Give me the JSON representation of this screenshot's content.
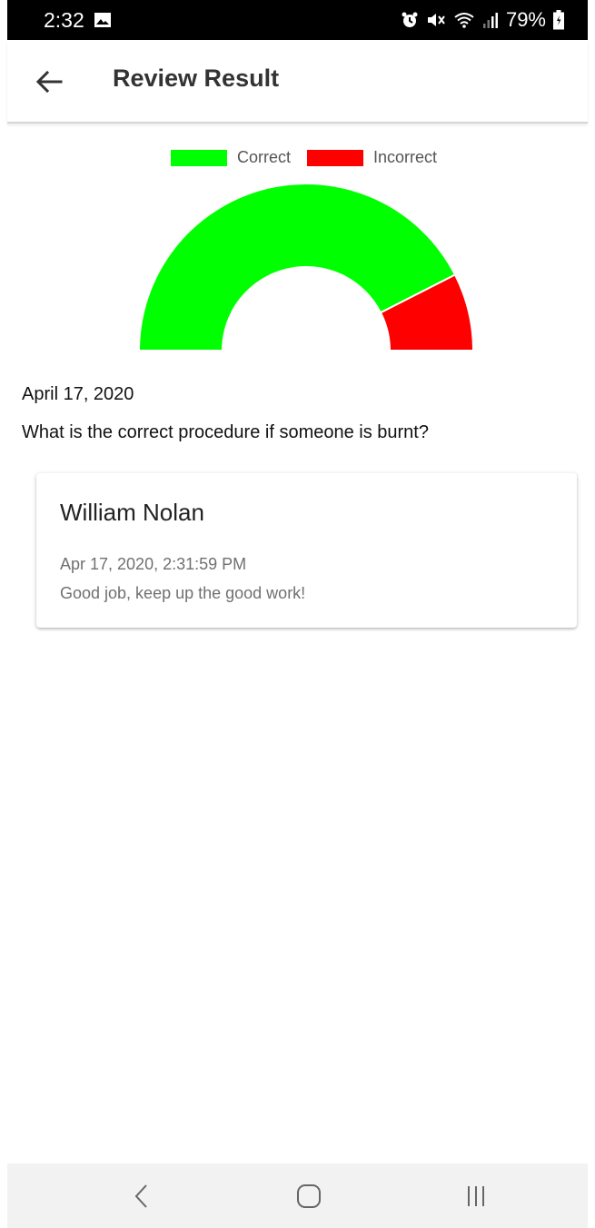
{
  "status_bar": {
    "time": "2:32",
    "battery": "79%",
    "icons": [
      "gallery-icon",
      "alarm-icon",
      "mute-icon",
      "wifi-icon",
      "signal-icon",
      "battery-icon"
    ]
  },
  "app_bar": {
    "title": "Review Result",
    "back_icon": "arrow-left-icon"
  },
  "chart_data": {
    "type": "pie",
    "style": "semi-donut",
    "categories": [
      "Correct",
      "Incorrect"
    ],
    "values": [
      85,
      15
    ],
    "colors": [
      "#00ff00",
      "#ff0000"
    ],
    "legend_position": "top"
  },
  "result": {
    "date": "April 17, 2020",
    "question": "What is the correct procedure if someone is burnt?"
  },
  "feedback": {
    "reviewer": "William Nolan",
    "timestamp": "Apr 17, 2020, 2:31:59 PM",
    "comment": "Good job, keep up the good work!"
  },
  "nav_bar": {
    "buttons": [
      "back-chevron-icon",
      "home-icon",
      "recents-icon"
    ]
  }
}
